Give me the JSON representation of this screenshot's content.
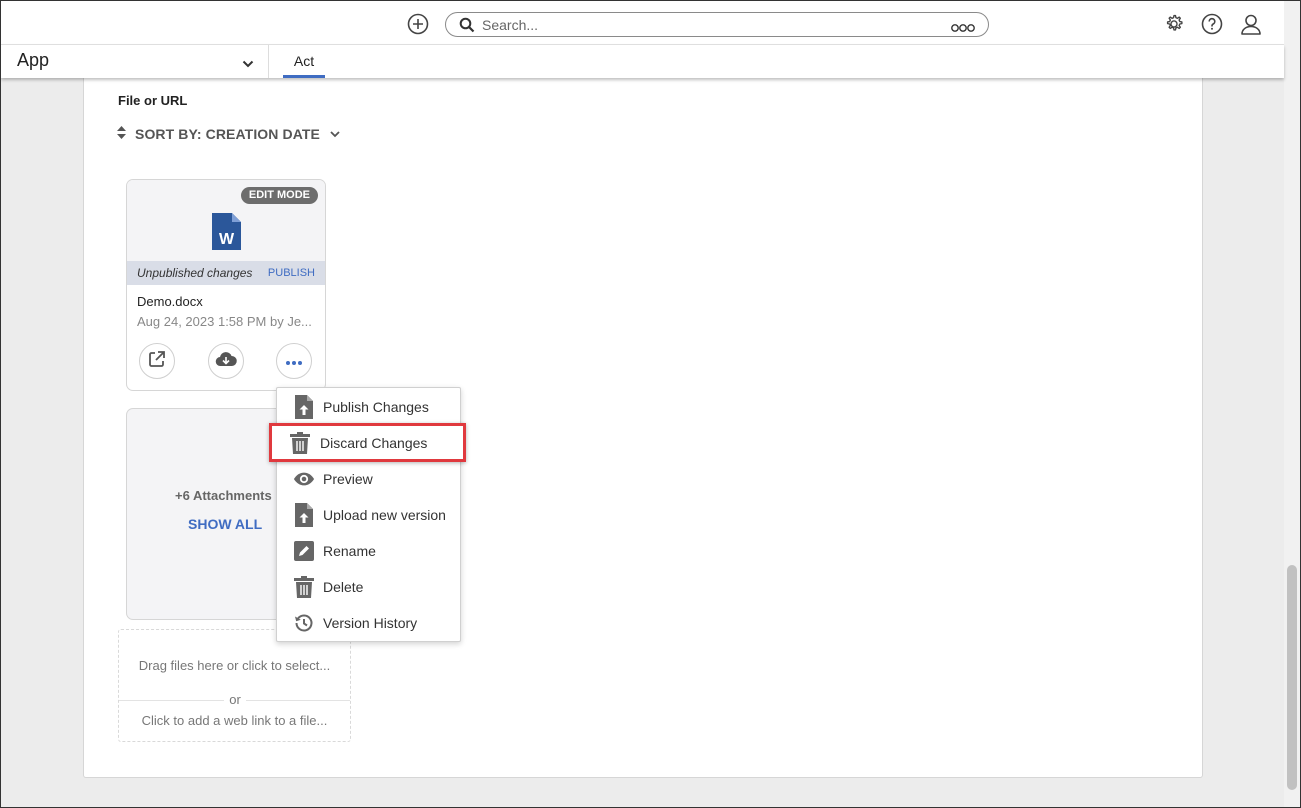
{
  "topbar": {
    "search_placeholder": "Search...",
    "icons": [
      "add-circle-icon",
      "search-icon",
      "more-dots-icon",
      "gear-icon",
      "help-icon",
      "user-icon"
    ]
  },
  "appbar": {
    "app_label": "App",
    "tab_label": "Act"
  },
  "section": {
    "title": "File or URL",
    "sort_label": "SORT BY: CREATION DATE"
  },
  "file_card": {
    "badge": "EDIT MODE",
    "unpublished_text": "Unpublished changes",
    "publish_label": "PUBLISH",
    "file_name": "Demo.docx",
    "meta": "Aug 24, 2023 1:58 PM by Je...",
    "icon_letter": "W"
  },
  "attachments": {
    "count_label": "+6 Attachments",
    "show_all": "SHOW ALL"
  },
  "dropzone": {
    "drag_text": "Drag files here or click to select...",
    "or_text": "or",
    "link_text": "Click to add a web link to a file..."
  },
  "menu": {
    "items": [
      {
        "label": "Publish Changes",
        "icon": "upload-file-icon"
      },
      {
        "label": "Discard Changes",
        "icon": "trash-icon"
      },
      {
        "label": "Preview",
        "icon": "eye-icon"
      },
      {
        "label": "Upload new version",
        "icon": "upload-file-icon"
      },
      {
        "label": "Rename",
        "icon": "pencil-icon"
      },
      {
        "label": "Delete",
        "icon": "trash-icon"
      },
      {
        "label": "Version History",
        "icon": "history-icon"
      }
    ]
  },
  "colors": {
    "accent": "#3f6cc2",
    "highlight_border": "#e0393e",
    "word_blue": "#2b579a"
  }
}
